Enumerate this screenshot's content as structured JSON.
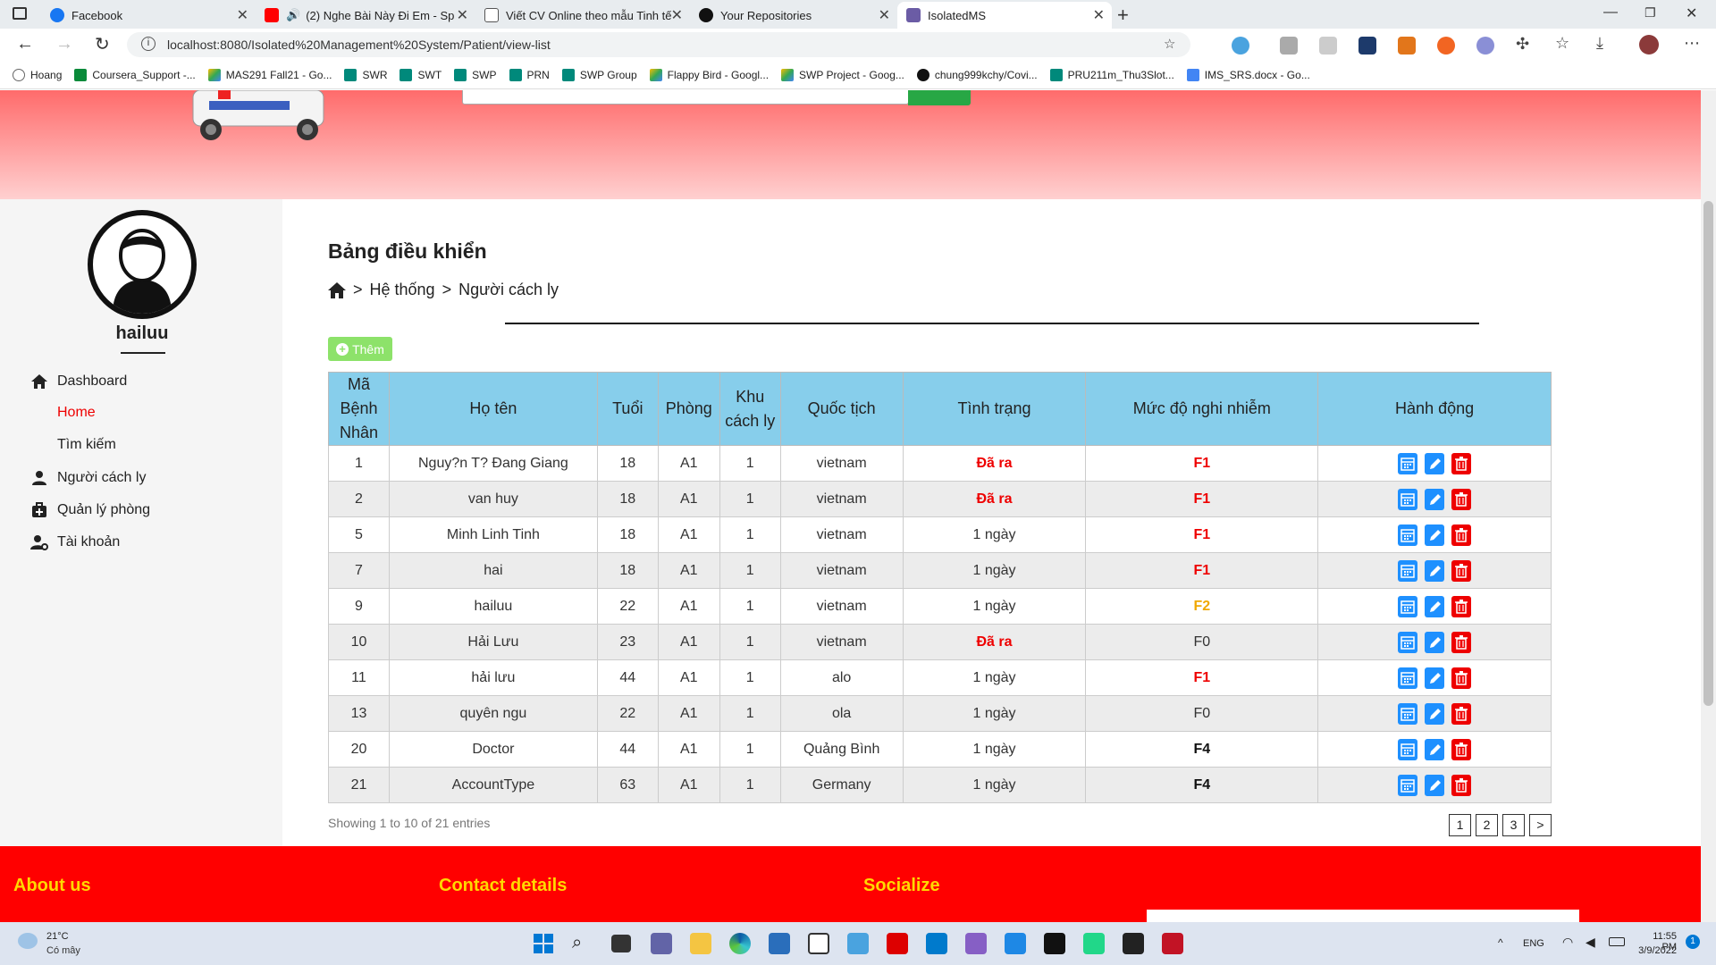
{
  "browser": {
    "tabs": [
      {
        "title": "Facebook",
        "color": "#1877f2"
      },
      {
        "title": "(2) Nghe Bài Này Đi Em - Sp",
        "color": "#ff0000"
      },
      {
        "title": "Viết CV Online theo mẫu Tinh tế",
        "color": "#666666"
      },
      {
        "title": "Your Repositories",
        "color": "#111111"
      },
      {
        "title": "IsolatedMS",
        "color": "#6b5ca5"
      }
    ],
    "url": "localhost:8080/Isolated%20Management%20System/Patient/view-list",
    "bookmarks": [
      "Hoang",
      "Coursera_Support -...",
      "MAS291 Fall21 - Go...",
      "SWR",
      "SWT",
      "SWP",
      "PRN",
      "SWP Group",
      "Flappy Bird - Googl...",
      "SWP Project - Goog...",
      "chung999kchy/Covi...",
      "PRU211m_Thu3Slot...",
      "IMS_SRS.docx - Go..."
    ]
  },
  "sidebar": {
    "username": "hailuu",
    "items": [
      {
        "label": "Dashboard",
        "icon": "home-icon"
      },
      {
        "label": "Home",
        "icon": "",
        "active": true
      },
      {
        "label": "Tìm kiếm",
        "icon": ""
      },
      {
        "label": "Người cách ly",
        "icon": "user-icon"
      },
      {
        "label": "Quản lý phòng",
        "icon": "medkit-icon"
      },
      {
        "label": "Tài khoản",
        "icon": "user-gear-icon"
      }
    ]
  },
  "main": {
    "title": "Bảng điều khiển",
    "breadcrumb": {
      "sep": ">",
      "item1": "Hệ thống",
      "item2": "Người cách ly"
    },
    "add_label": "Thêm",
    "table": {
      "headers": [
        "Mã Bệnh Nhân",
        "Họ tên",
        "Tuổi",
        "Phòng",
        "Khu cách ly",
        "Quốc tịch",
        "Tình trạng",
        "Mức độ nghi nhiễm",
        "Hành động"
      ],
      "rows": [
        {
          "id": "1",
          "name": "Nguy?n T? Đang Giang",
          "age": "18",
          "room": "A1",
          "zone": "1",
          "nation": "vietnam",
          "status": "Đã ra",
          "level": "F1"
        },
        {
          "id": "2",
          "name": "van huy",
          "age": "18",
          "room": "A1",
          "zone": "1",
          "nation": "vietnam",
          "status": "Đã ra",
          "level": "F1"
        },
        {
          "id": "5",
          "name": "Minh Linh Tinh",
          "age": "18",
          "room": "A1",
          "zone": "1",
          "nation": "vietnam",
          "status": "1 ngày",
          "level": "F1"
        },
        {
          "id": "7",
          "name": "hai",
          "age": "18",
          "room": "A1",
          "zone": "1",
          "nation": "vietnam",
          "status": "1 ngày",
          "level": "F1"
        },
        {
          "id": "9",
          "name": "hailuu",
          "age": "22",
          "room": "A1",
          "zone": "1",
          "nation": "vietnam",
          "status": "1 ngày",
          "level": "F2"
        },
        {
          "id": "10",
          "name": "Hải Lưu",
          "age": "23",
          "room": "A1",
          "zone": "1",
          "nation": "vietnam",
          "status": "Đã ra",
          "level": "F0"
        },
        {
          "id": "11",
          "name": "hải lưu",
          "age": "44",
          "room": "A1",
          "zone": "1",
          "nation": "alo",
          "status": "1 ngày",
          "level": "F1"
        },
        {
          "id": "13",
          "name": "quyên ngu",
          "age": "22",
          "room": "A1",
          "zone": "1",
          "nation": "ola",
          "status": "1 ngày",
          "level": "F0"
        },
        {
          "id": "20",
          "name": "Doctor",
          "age": "44",
          "room": "A1",
          "zone": "1",
          "nation": "Quảng Bình",
          "status": "1 ngày",
          "level": "F4"
        },
        {
          "id": "21",
          "name": "AccountType",
          "age": "63",
          "room": "A1",
          "zone": "1",
          "nation": "Germany",
          "status": "1 ngày",
          "level": "F4"
        }
      ]
    },
    "showing": "Showing 1 to 10 of 21 entries",
    "pages": [
      "1",
      "2",
      "3",
      ">"
    ]
  },
  "footer": {
    "about": "About us",
    "contact": "Contact details",
    "socialize": "Socialize"
  },
  "taskbar": {
    "weather_temp": "21°C",
    "weather_desc": "Có mây",
    "lang": "ENG",
    "time": "11:55 PM",
    "date": "3/9/2022",
    "notif": "1"
  }
}
